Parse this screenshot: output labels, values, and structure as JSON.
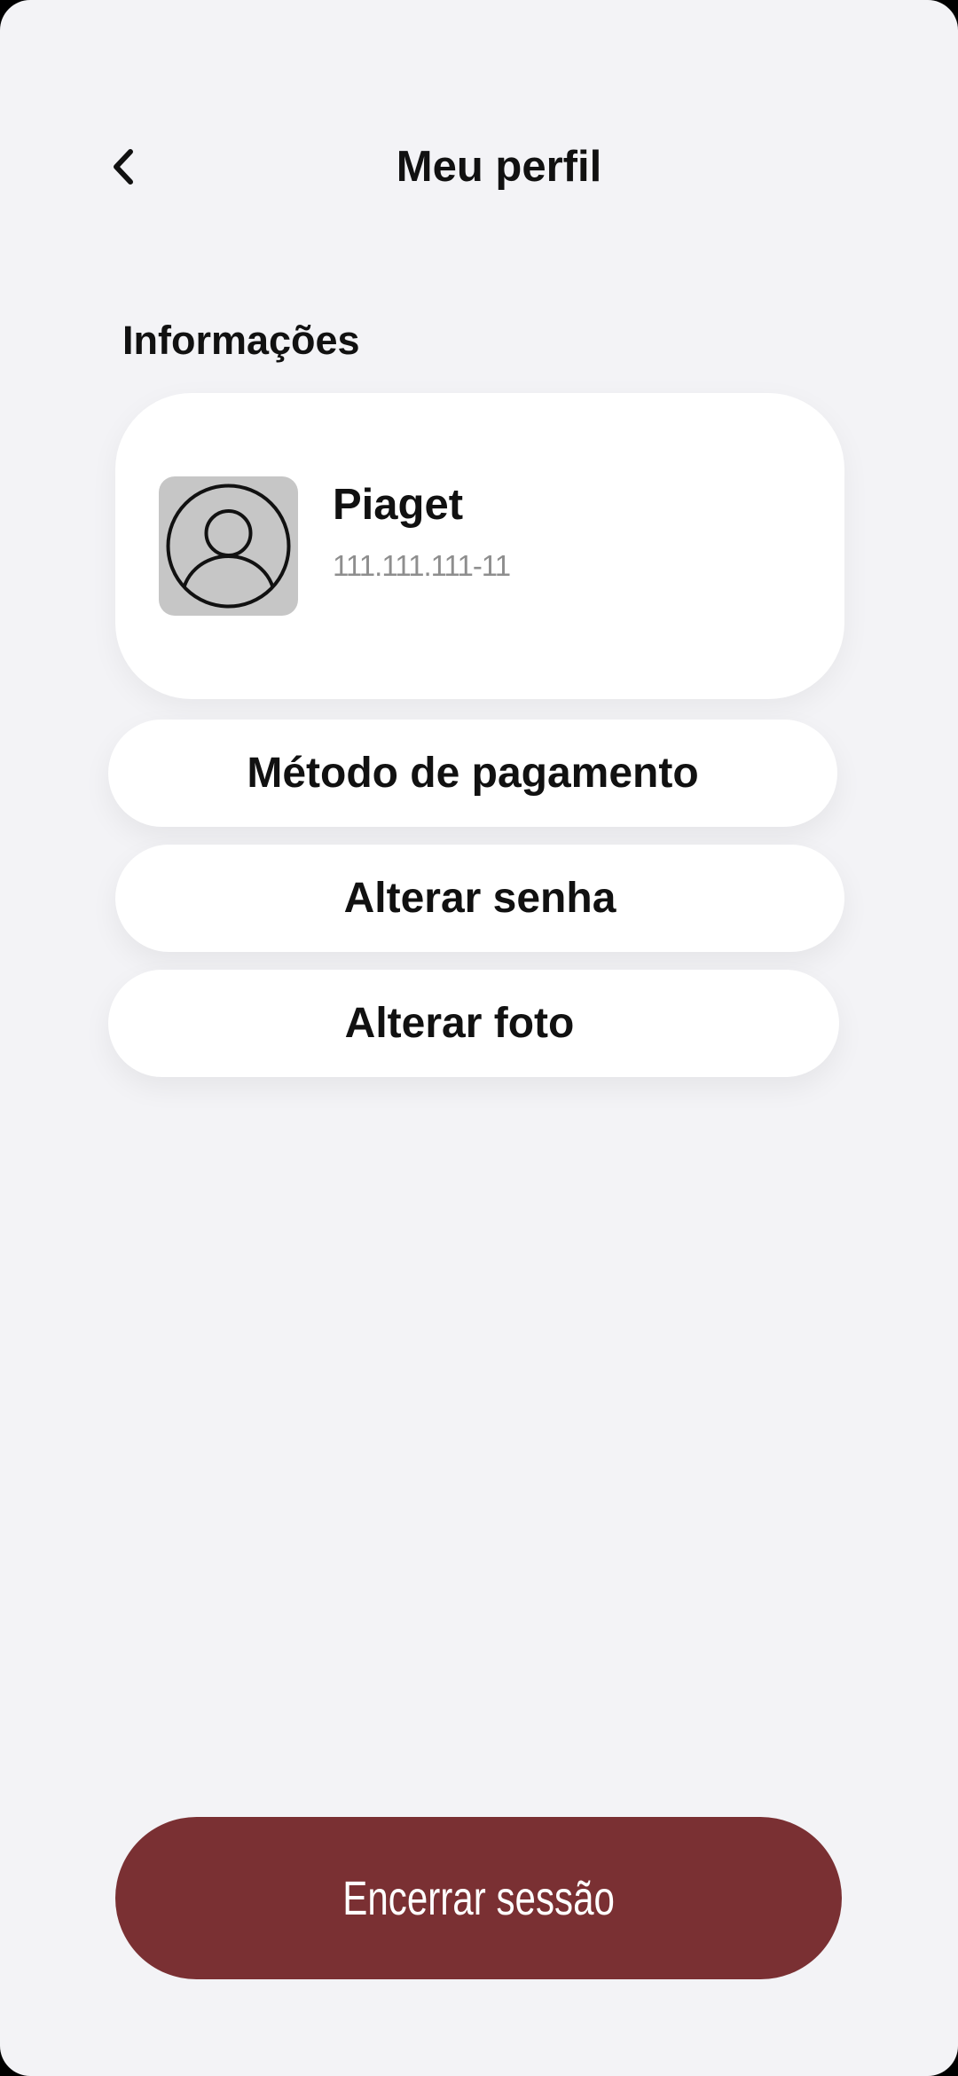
{
  "header": {
    "back_icon": "chevron-left-icon",
    "title": "Meu perfil"
  },
  "info": {
    "section_title": "Informações",
    "profile": {
      "avatar_icon": "user-avatar-icon",
      "name": "Piaget",
      "document": "111.111.111-11"
    }
  },
  "menu": {
    "payment_label": "Método de pagamento",
    "change_password_label": "Alterar senha",
    "change_photo_label": "Alterar foto"
  },
  "footer": {
    "logout_label": "Encerrar sessão"
  },
  "colors": {
    "background": "#f3f3f6",
    "card": "#ffffff",
    "accent": "#7a3033",
    "avatar_bg": "#c6c6c6",
    "secondary_text": "#8e8e8e"
  }
}
